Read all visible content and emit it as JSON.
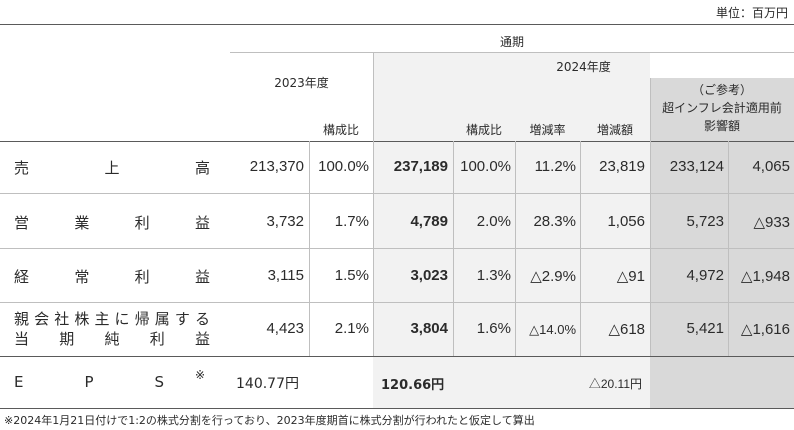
{
  "unit": "単位：百万円",
  "header": {
    "period": "通期",
    "fy2023": "2023年度",
    "fy2024": "2024年度",
    "ratio": "構成比",
    "ratio2": "構成比",
    "change_rate": "増減率",
    "change_amount": "増減額",
    "ref_line1": "（ご参考）",
    "ref_line2": "超インフレ会計適用前",
    "ref_line3": "影響額"
  },
  "rows": [
    {
      "label_chars": [
        "売",
        "上",
        "高"
      ],
      "v2023": "213,370",
      "r2023": "100.0%",
      "v2024": "237,189",
      "r2024": "100.0%",
      "rate": "11.2%",
      "amount": "23,819",
      "ref": "233,124",
      "impact": "4,065"
    },
    {
      "label_chars": [
        "営",
        "業",
        "利",
        "益"
      ],
      "v2023": "3,732",
      "r2023": "1.7%",
      "v2024": "4,789",
      "r2024": "2.0%",
      "rate": "28.3%",
      "amount": "1,056",
      "ref": "5,723",
      "impact": "△933"
    },
    {
      "label_chars": [
        "経",
        "常",
        "利",
        "益"
      ],
      "v2023": "3,115",
      "r2023": "1.5%",
      "v2024": "3,023",
      "r2024": "1.3%",
      "rate": "△2.9%",
      "amount": "△91",
      "ref": "4,972",
      "impact": "△1,948"
    },
    {
      "label_line1": [
        "親",
        "会",
        "社",
        "株",
        "主",
        "に",
        "帰",
        "属",
        "す",
        "る"
      ],
      "label_line2": [
        "当",
        "期",
        "純",
        "利",
        "益"
      ],
      "v2023": "4,423",
      "r2023": "2.1%",
      "v2024": "3,804",
      "r2024": "1.6%",
      "rate": "△14.0%",
      "amount": "△618",
      "ref": "5,421",
      "impact": "△1,616"
    }
  ],
  "eps": {
    "label_chars": [
      "E",
      "P",
      "S"
    ],
    "mark": "※",
    "v2023": "140.77円",
    "v2024": "120.66円",
    "amount": "△20.11円"
  },
  "footnote": "※2024年1月21日付けで1:2の株式分割を行っており、2023年度期首に株式分割が行われたと仮定して算出"
}
